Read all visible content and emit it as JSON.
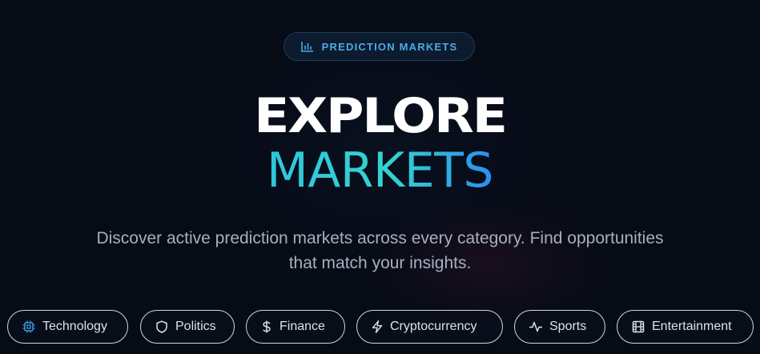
{
  "badge": {
    "icon": "bar-chart-icon",
    "label": "PREDICTION MARKETS",
    "color": "#4fa9e6"
  },
  "hero": {
    "title_line1": "EXPLORE",
    "title_line2": "MARKETS",
    "subtitle": "Discover active prediction markets across every category. Find opportunities that match your insights."
  },
  "categories": [
    {
      "label": "Technology",
      "icon": "chip-icon",
      "active": true
    },
    {
      "label": "Politics",
      "icon": "shield-icon",
      "active": false
    },
    {
      "label": "Finance",
      "icon": "dollar-icon",
      "active": false
    },
    {
      "label": "Cryptocurrency",
      "icon": "lightning-icon",
      "active": false
    },
    {
      "label": "Sports",
      "icon": "activity-icon",
      "active": false
    },
    {
      "label": "Entertainment",
      "icon": "film-icon",
      "active": false
    }
  ],
  "colors": {
    "background": "#060b16",
    "accent_blue": "#2a8ff0",
    "accent_teal": "#34d2cf",
    "chip_border": "#cfd6e0"
  }
}
